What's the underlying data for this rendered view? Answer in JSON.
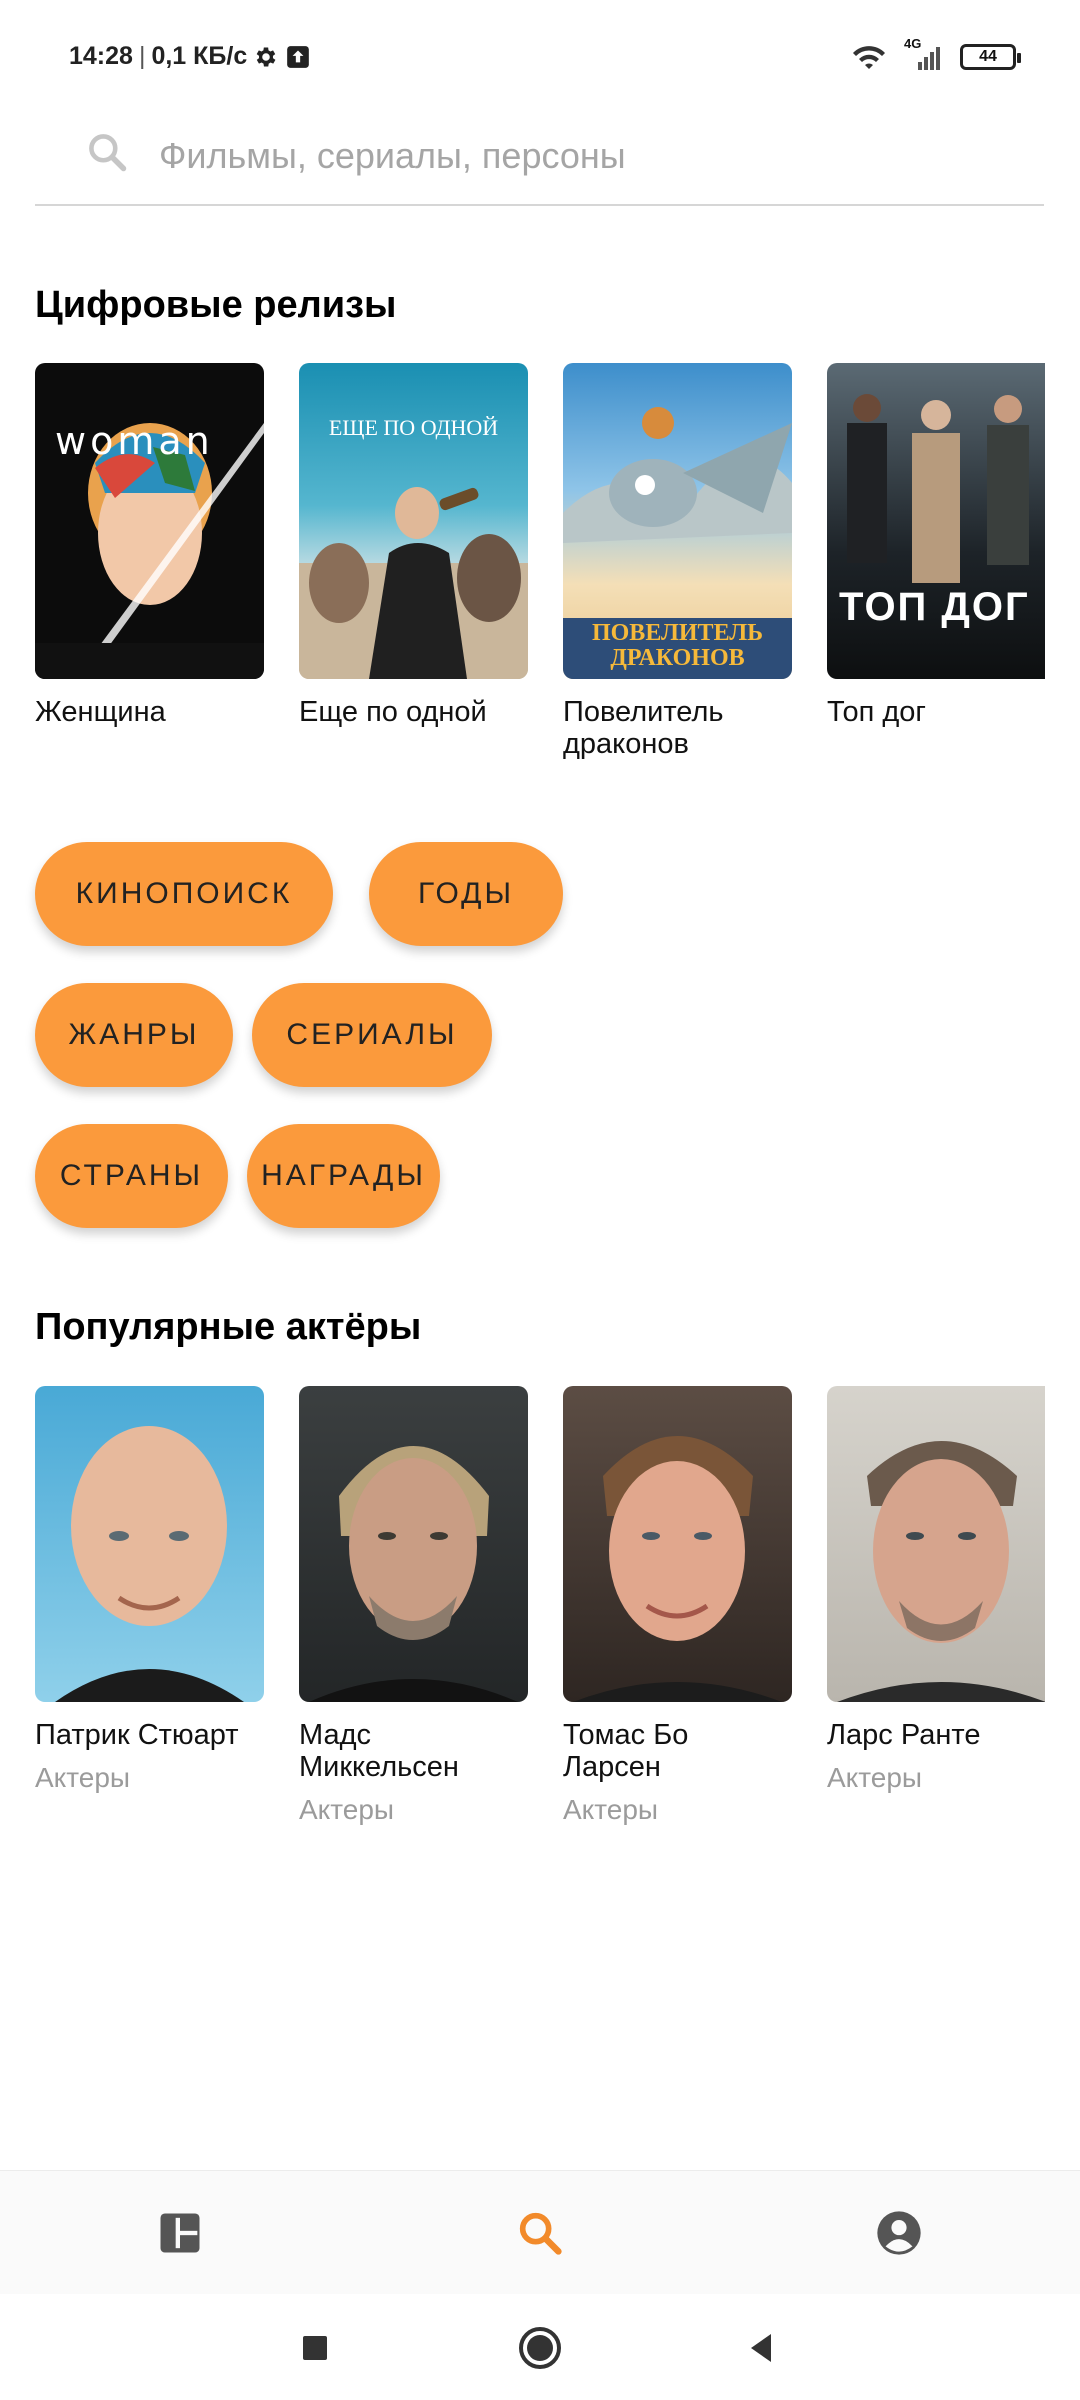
{
  "status": {
    "time": "14:28",
    "speed": "0,1 КБ/с",
    "network": "4G",
    "battery": "44"
  },
  "search": {
    "placeholder": "Фильмы, сериалы, персоны",
    "icon": "search-icon"
  },
  "releases": {
    "title": "Цифровые релизы",
    "items": [
      {
        "title": "Женщина",
        "poster_text": "woman"
      },
      {
        "title": "Еще по одной",
        "poster_text": "ЕЩЕ ПО ОДНОЙ"
      },
      {
        "title": "Повелитель драконов",
        "poster_text": "ПОВЕЛИТЕЛЬ ДРАКОНОВ"
      },
      {
        "title": "Топ дог",
        "poster_text": "ТОП ДОГ"
      }
    ]
  },
  "chips": [
    "КИНОПОИСК",
    "ГОДЫ",
    "ЖАНРЫ",
    "СЕРИАЛЫ",
    "СТРАНЫ",
    "НАГРАДЫ"
  ],
  "actors": {
    "title": "Популярные актёры",
    "items": [
      {
        "name": "Патрик Стюарт",
        "role": "Актеры"
      },
      {
        "name": "Мадс Миккельсен",
        "role": "Актеры"
      },
      {
        "name": "Томас Бо Ларсен",
        "role": "Актеры"
      },
      {
        "name": "Ларс Ранте",
        "role": "Актеры"
      }
    ]
  },
  "tabs": [
    {
      "icon": "dashboard-icon",
      "active": false
    },
    {
      "icon": "search-icon",
      "active": true
    },
    {
      "icon": "account-icon",
      "active": false
    }
  ],
  "colors": {
    "accent": "#fb9a3c",
    "tab_active": "#f28a2a",
    "tab_inactive": "#555555"
  }
}
